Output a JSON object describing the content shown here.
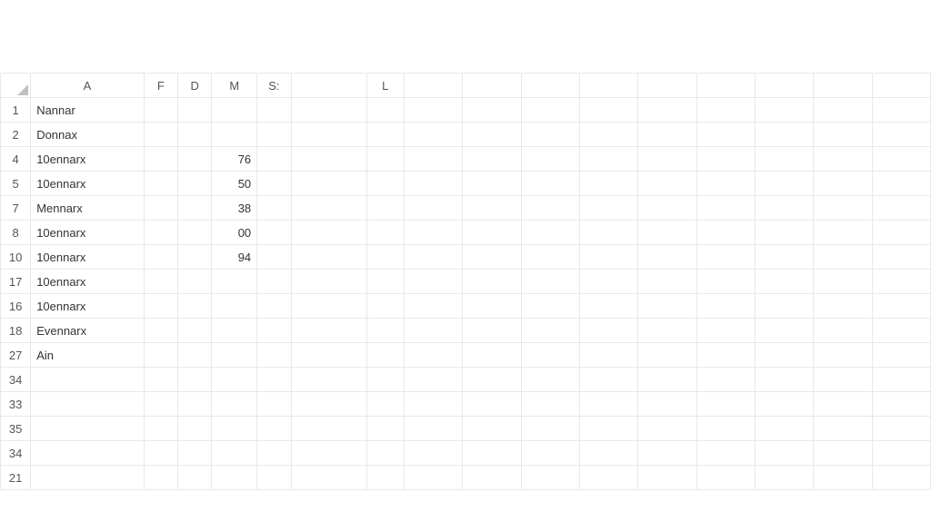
{
  "columns": {
    "A": "A",
    "F": "F",
    "D": "D",
    "M": "M",
    "S": "S:",
    "L": "L"
  },
  "rows": [
    {
      "num": "1",
      "A": "Nannar",
      "M": ""
    },
    {
      "num": "2",
      "A": "Donnax",
      "M": ""
    },
    {
      "num": "4",
      "A": "10ennarx",
      "M": "76"
    },
    {
      "num": "5",
      "A": "10ennarx",
      "M": "50"
    },
    {
      "num": "7",
      "A": "Mennarx",
      "M": "38"
    },
    {
      "num": "8",
      "A": "10ennarx",
      "M": "00"
    },
    {
      "num": "10",
      "A": "10ennarx",
      "M": "94"
    },
    {
      "num": "17",
      "A": "10ennarx",
      "M": ""
    },
    {
      "num": "16",
      "A": "10ennarx",
      "M": ""
    },
    {
      "num": "18",
      "A": "Evennarx",
      "M": ""
    },
    {
      "num": "27",
      "A": "Ain",
      "M": ""
    },
    {
      "num": "34",
      "A": "",
      "M": ""
    },
    {
      "num": "33",
      "A": "",
      "M": ""
    },
    {
      "num": "35",
      "A": "",
      "M": ""
    },
    {
      "num": "34",
      "A": "",
      "M": ""
    },
    {
      "num": "21",
      "A": "",
      "M": ""
    }
  ]
}
